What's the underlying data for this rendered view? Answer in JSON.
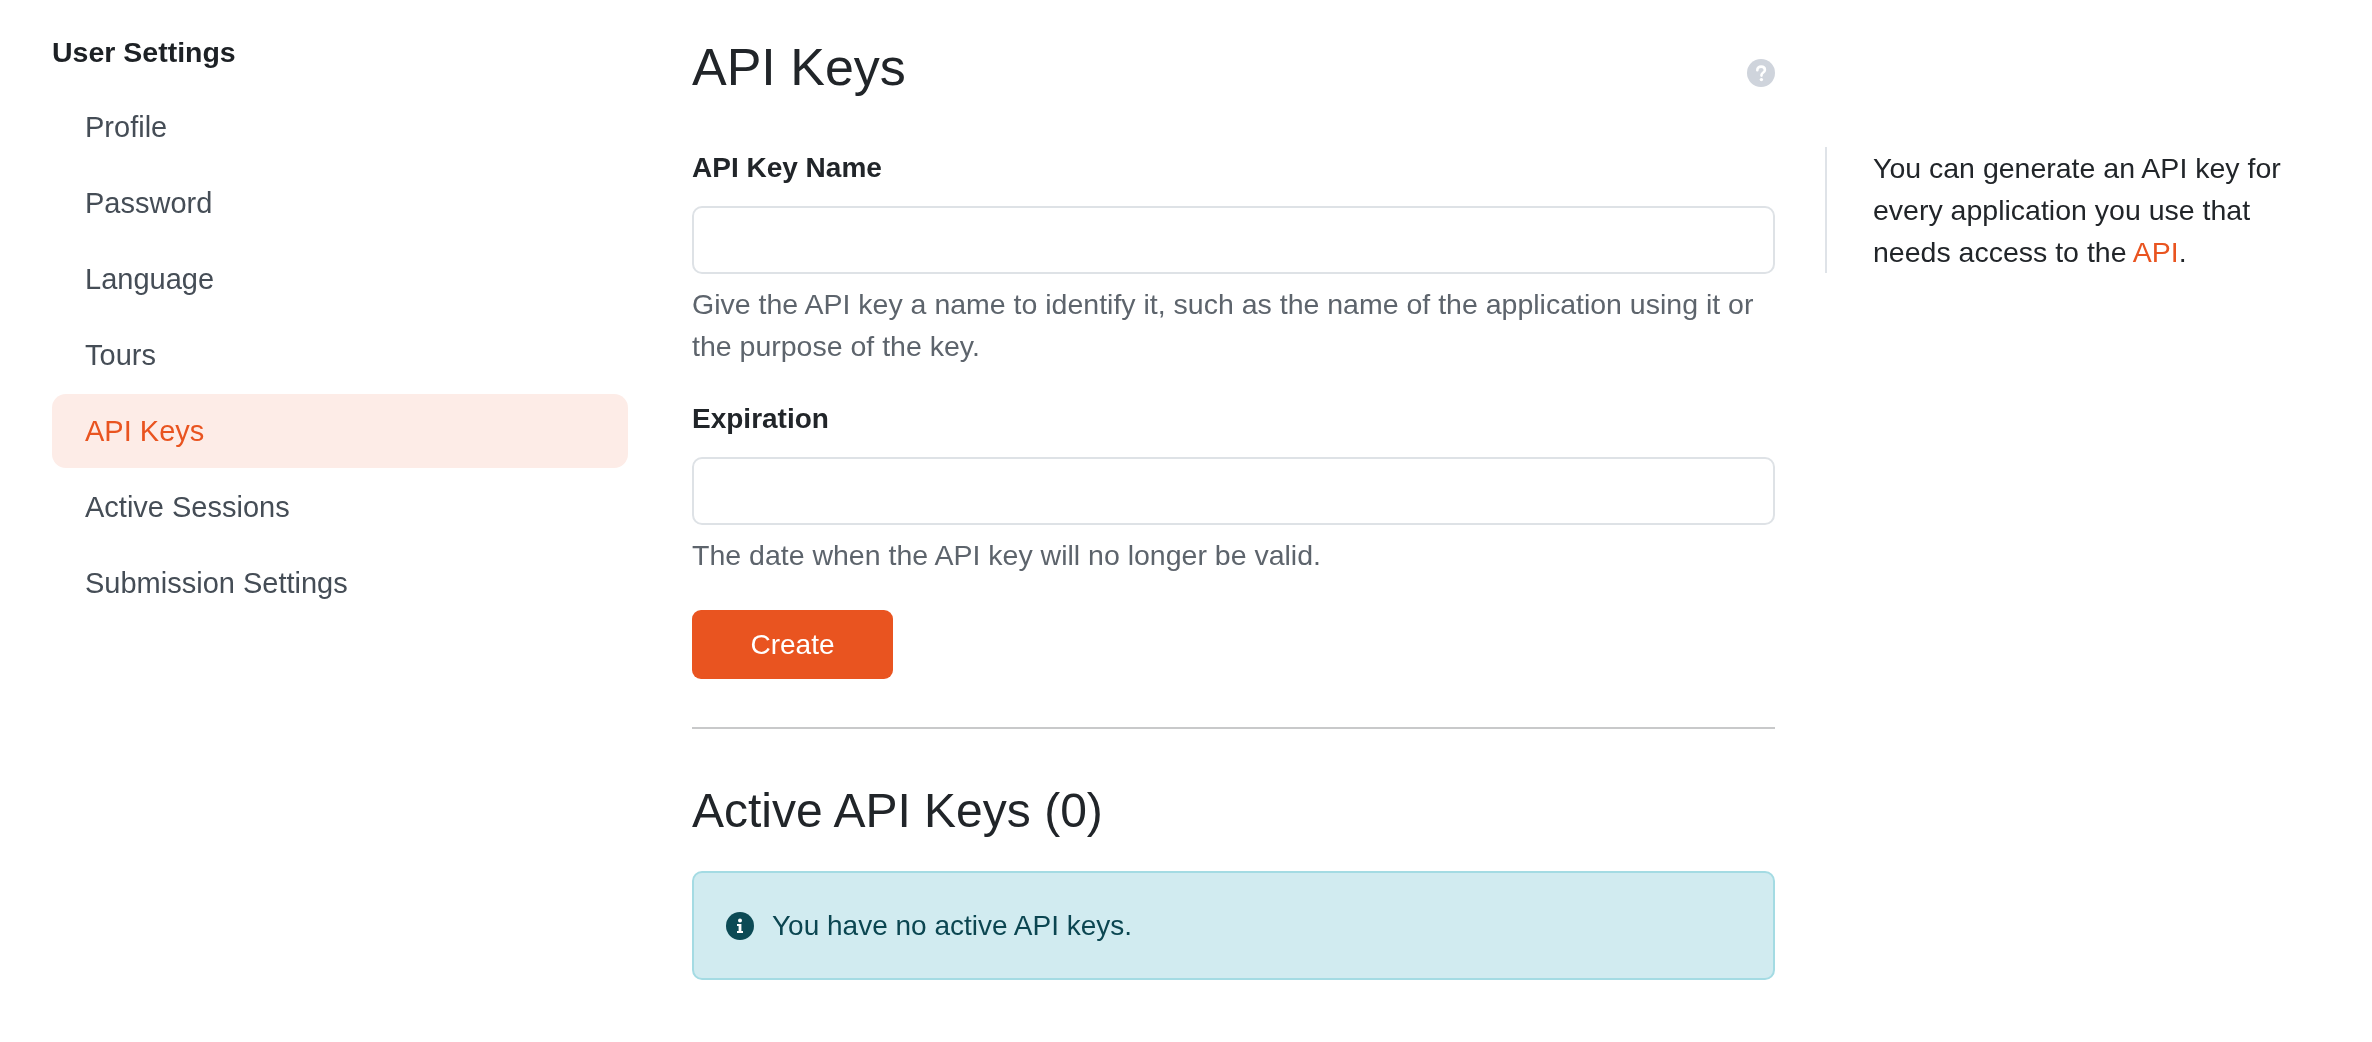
{
  "sidebar": {
    "title": "User Settings",
    "items": [
      {
        "label": "Profile",
        "selected": false
      },
      {
        "label": "Password",
        "selected": false
      },
      {
        "label": "Language",
        "selected": false
      },
      {
        "label": "Tours",
        "selected": false
      },
      {
        "label": "API Keys",
        "selected": true
      },
      {
        "label": "Active Sessions",
        "selected": false
      },
      {
        "label": "Submission Settings",
        "selected": false
      }
    ]
  },
  "page": {
    "title": "API Keys"
  },
  "form": {
    "fields": [
      {
        "label": "API Key Name",
        "help": "Give the API key a name to identify it, such as the name of the application using it or the purpose of the key."
      },
      {
        "label": "Expiration",
        "help": "The date when the API key will no longer be valid."
      }
    ],
    "submit": "Create"
  },
  "active_keys": {
    "title": "Active API Keys (0)",
    "alert": "You have no active API keys."
  },
  "aside": {
    "text_before": "You can generate an API key for every application you use that needs access to the ",
    "link": "API",
    "text_after": "."
  }
}
